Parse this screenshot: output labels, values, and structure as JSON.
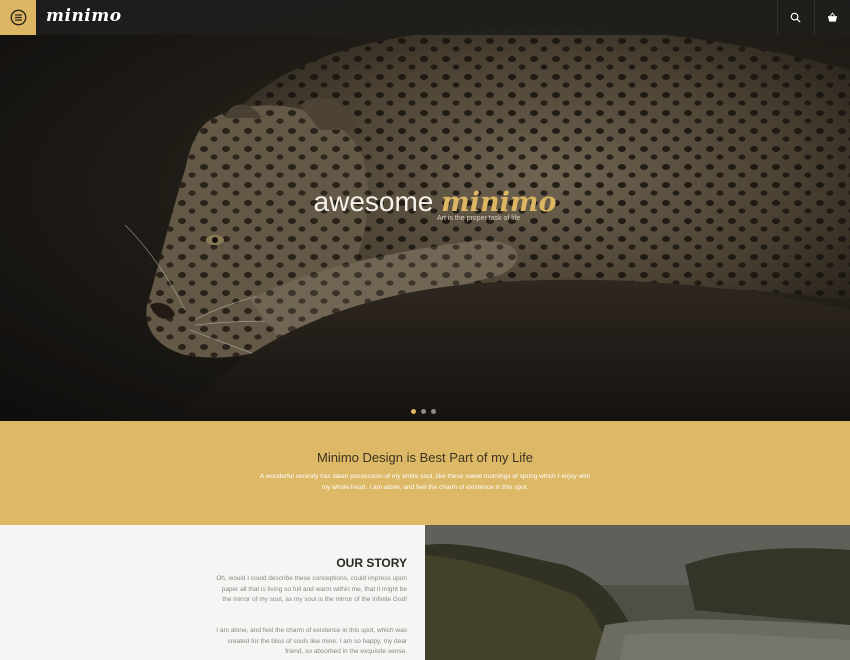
{
  "header": {
    "logo": "minimo",
    "icons": {
      "menu": "hamburger-menu-icon",
      "search": "search-icon",
      "cart": "shopping-basket-icon"
    }
  },
  "hero": {
    "title_plain": "awesome",
    "title_accent": "minimo",
    "subtitle": "Art is the proper task of life",
    "slides_total": 3,
    "active_slide": 1
  },
  "intro": {
    "heading": "Minimo Design is Best Part of my Life",
    "text": "A wonderful serenity has taken possession of my entire soul, like these sweet mornings of spring which I enjoy with my whole heart. I am alone, and feel the charm of existence in this spot."
  },
  "story": {
    "heading": "OUR STORY",
    "p1": "Oh, would I could describe these conceptions, could impress upon paper all that is living so full and warm within me, that it might be the mirror of my soul, as my soul is the mirror of the infinite God!",
    "p2": "I am alone, and feel the charm of existence in this spot, which was created for the bliss of souls like mine. I am so happy, my dear friend, so absorbed in the exquisite sense."
  },
  "colors": {
    "accent": "#dcb663",
    "band": "#dcb867",
    "header": "#201e1c",
    "story_bg": "#f6f5f3"
  }
}
